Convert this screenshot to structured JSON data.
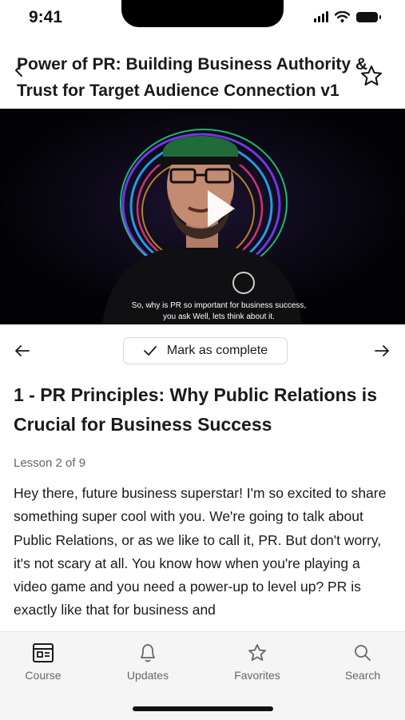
{
  "status_bar": {
    "time": "9:41"
  },
  "header": {
    "title": "Power of PR: Building Business Authority & Trust for Target Audience Connection v1"
  },
  "video": {
    "caption_line1": "So, why is PR so important for business success,",
    "caption_line2": "you ask Well, lets think about it."
  },
  "lesson_controls": {
    "complete_label": "Mark as complete"
  },
  "lesson": {
    "title": "1 - PR Principles: Why Public Relations is Crucial for Business Success",
    "count": "Lesson 2 of 9",
    "body": "Hey there, future business superstar! I'm so excited to share something super cool with you. We're going to talk about Public Relations, or as we like to call it, PR. But don't worry, it's not scary at all. You know how when you're playing a video game and you need a power-up to level up? PR is exactly like that for business and"
  },
  "tabs": [
    {
      "label": "Course",
      "icon": "course-icon"
    },
    {
      "label": "Updates",
      "icon": "bell-icon"
    },
    {
      "label": "Favorites",
      "icon": "star-icon"
    },
    {
      "label": "Search",
      "icon": "search-icon"
    }
  ],
  "colors": {
    "text": "#1a1a1a",
    "muted": "#666666",
    "tab_bg": "#f5f5f5",
    "video_bg": "#030306"
  }
}
